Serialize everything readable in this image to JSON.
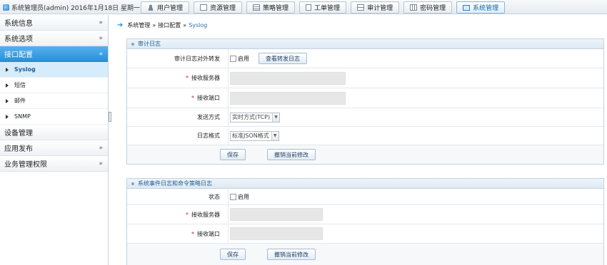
{
  "header": {
    "user_info": "系统管理员(admin)  2016年1月18日 星期一",
    "tabs": [
      {
        "label": "用户管理",
        "icon": "user-icon"
      },
      {
        "label": "资源管理",
        "icon": "resource-icon"
      },
      {
        "label": "策略管理",
        "icon": "policy-icon"
      },
      {
        "label": "工单管理",
        "icon": "ticket-icon"
      },
      {
        "label": "审计管理",
        "icon": "audit-icon"
      },
      {
        "label": "密码管理",
        "icon": "password-icon"
      },
      {
        "label": "系统管理",
        "icon": "system-icon",
        "active": true
      }
    ]
  },
  "sidebar": {
    "items": [
      {
        "label": "系统信息",
        "chev": "»"
      },
      {
        "label": "系统选项",
        "chev": "»"
      },
      {
        "label": "接口配置",
        "chev": "«",
        "active": true
      },
      {
        "label": "设备管理",
        "chev": ""
      },
      {
        "label": "应用发布",
        "chev": "»"
      },
      {
        "label": "业务管理权限",
        "chev": "»"
      }
    ],
    "subitems": [
      {
        "label": "Syslog",
        "active": true
      },
      {
        "label": "短信"
      },
      {
        "label": "邮件"
      },
      {
        "label": "SNMP"
      }
    ]
  },
  "breadcrumb": {
    "root": "系统管理",
    "sep": "»",
    "parent": "接口配置",
    "current": "Syslog"
  },
  "audit_panel": {
    "title": "审计日志",
    "forward_label": "审计日志对外转发",
    "enable_label": "启用",
    "view_button": "查看转发日志",
    "server_label": "接收服务器",
    "port_label": "接收端口",
    "mode_label": "发送方式",
    "mode_value": "实时方式(TCP)",
    "format_label": "日志格式",
    "format_value": "标准JSON格式",
    "save_button": "保存",
    "cancel_button": "撤销当前修改",
    "required_mark": "*"
  },
  "event_panel": {
    "title": "系统事件日志和命令策略日志",
    "status_label": "状态",
    "enable_label": "启用",
    "server_label": "接收服务器",
    "port_label": "接收端口",
    "save_button": "保存",
    "cancel_button": "撤销当前修改",
    "required_mark": "*"
  }
}
